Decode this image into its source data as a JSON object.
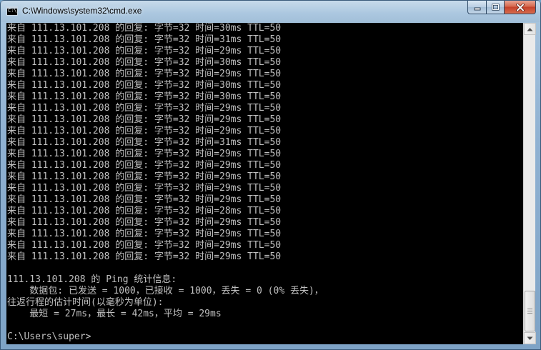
{
  "window": {
    "title": "C:\\Windows\\system32\\cmd.exe",
    "icon": "cmd-console-icon",
    "icon_glyph": "C:\\",
    "buttons": {
      "minimize": "minimize-icon",
      "maximize": "maximize-icon",
      "close": "close-icon"
    }
  },
  "console": {
    "text_color": "#c0c0c0",
    "background": "#000000",
    "lines": [
      "来自 111.13.101.208 的回复: 字节=32 时间=30ms TTL=50",
      "来自 111.13.101.208 的回复: 字节=32 时间=31ms TTL=50",
      "来自 111.13.101.208 的回复: 字节=32 时间=29ms TTL=50",
      "来自 111.13.101.208 的回复: 字节=32 时间=30ms TTL=50",
      "来自 111.13.101.208 的回复: 字节=32 时间=29ms TTL=50",
      "来自 111.13.101.208 的回复: 字节=32 时间=30ms TTL=50",
      "来自 111.13.101.208 的回复: 字节=32 时间=30ms TTL=50",
      "来自 111.13.101.208 的回复: 字节=32 时间=29ms TTL=50",
      "来自 111.13.101.208 的回复: 字节=32 时间=29ms TTL=50",
      "来自 111.13.101.208 的回复: 字节=32 时间=29ms TTL=50",
      "来自 111.13.101.208 的回复: 字节=32 时间=31ms TTL=50",
      "来自 111.13.101.208 的回复: 字节=32 时间=29ms TTL=50",
      "来自 111.13.101.208 的回复: 字节=32 时间=29ms TTL=50",
      "来自 111.13.101.208 的回复: 字节=32 时间=29ms TTL=50",
      "来自 111.13.101.208 的回复: 字节=32 时间=29ms TTL=50",
      "来自 111.13.101.208 的回复: 字节=32 时间=29ms TTL=50",
      "来自 111.13.101.208 的回复: 字节=32 时间=28ms TTL=50",
      "来自 111.13.101.208 的回复: 字节=32 时间=29ms TTL=50",
      "来自 111.13.101.208 的回复: 字节=32 时间=29ms TTL=50",
      "来自 111.13.101.208 的回复: 字节=32 时间=29ms TTL=50",
      "来自 111.13.101.208 的回复: 字节=32 时间=29ms TTL=50",
      "",
      "111.13.101.208 的 Ping 统计信息:",
      "    数据包: 已发送 = 1000，已接收 = 1000，丢失 = 0 (0% 丢失)，",
      "往返行程的估计时间(以毫秒为单位):",
      "    最短 = 27ms，最长 = 42ms，平均 = 29ms",
      "",
      "C:\\Users\\super>"
    ]
  },
  "scrollbar": {
    "up_icon": "scroll-up-arrow-icon",
    "down_icon": "scroll-down-arrow-icon",
    "position": 0.96
  }
}
